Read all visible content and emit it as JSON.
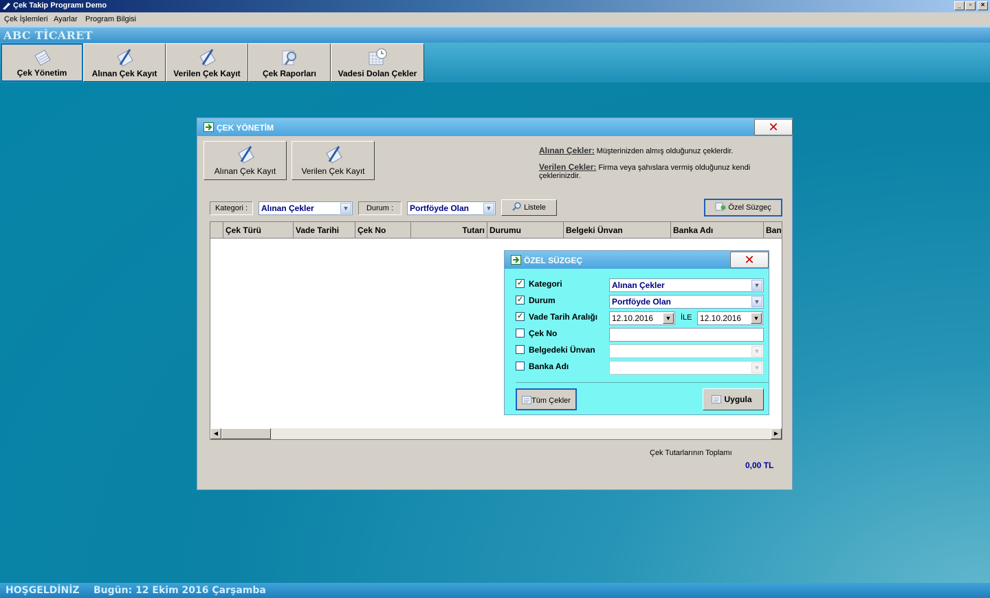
{
  "app": {
    "title": "Çek Takip Programı Demo"
  },
  "menu": [
    "Çek İşlemleri",
    "Ayarlar",
    "Program Bilgisi"
  ],
  "company": "ABC TİCARET",
  "toolbar": [
    "Çek Yönetim",
    "Alınan Çek Kayıt",
    "Verilen Çek Kayıt",
    "Çek Raporları",
    "Vadesi Dolan Çekler"
  ],
  "status": {
    "welcome": "HOŞGELDİNİZ",
    "today": "Bugün: 12 Ekim 2016 Çarşamba"
  },
  "dialog": {
    "title": "ÇEK YÖNETİM",
    "buttons": [
      "Alınan Çek Kayıt",
      "Verilen Çek Kayıt"
    ],
    "info": [
      {
        "term": "Alınan Çekler:",
        "desc": "Müşterinizden almış olduğunuz çeklerdir."
      },
      {
        "term": "Verilen Çekler:",
        "desc": "Firma veya şahıslara vermiş olduğunuz kendi çeklerinizdir."
      }
    ],
    "filter": {
      "category_label": "Kategori :",
      "category_value": "Alınan Çekler",
      "status_label": "Durum :",
      "status_value": "Portföyde Olan",
      "list_button": "Listele",
      "custom_button": "Özel Süzgeç"
    },
    "columns": [
      "Çek Türü",
      "Vade Tarihi",
      "Çek No",
      "Tutarı",
      "Durumu",
      "Belgeki Ünvan",
      "Banka Adı",
      "Banl"
    ],
    "total_label": "Çek Tutarlarının Toplamı",
    "total_value": "0,00 TL"
  },
  "custom_filter": {
    "title": "ÖZEL SÜZGEÇ",
    "rows": [
      {
        "label": "Kategori",
        "checked": true,
        "value": "Alınan Çekler"
      },
      {
        "label": "Durum",
        "checked": true,
        "value": "Portföyde Olan"
      },
      {
        "label": "Vade Tarih Aralığı",
        "checked": true,
        "from": "12.10.2016",
        "sep": "İLE",
        "to": "12.10.2016"
      },
      {
        "label": "Çek No",
        "checked": false,
        "value": ""
      },
      {
        "label": "Belgedeki Ünvan",
        "checked": false,
        "value": ""
      },
      {
        "label": "Banka Adı",
        "checked": false,
        "value": ""
      }
    ],
    "all_button": "Tüm Çekler",
    "apply_button": "Uygula"
  }
}
